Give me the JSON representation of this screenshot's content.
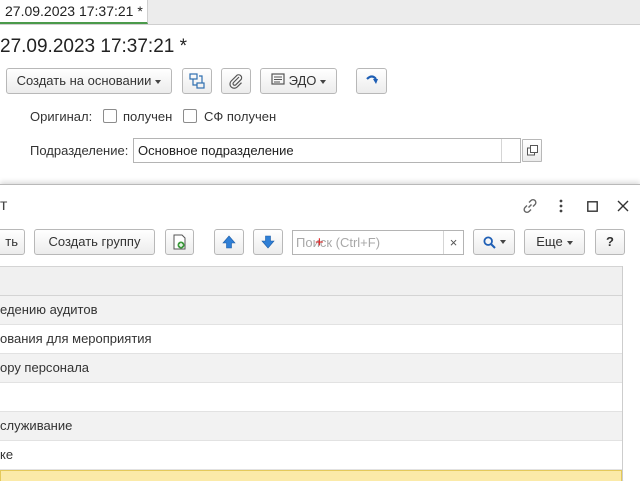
{
  "document": {
    "tab_label": "27.09.2023 17:37:21 *",
    "title": "27.09.2023 17:37:21 *",
    "toolbar": {
      "create_based_on": "Создать на основании",
      "edo": "ЭДО"
    },
    "original_label": "Оригинал:",
    "received_label": "получен",
    "sf_received_label": "СФ получен",
    "department_label": "Подразделение:",
    "department_value": "Основное подразделение"
  },
  "modal": {
    "title": "т",
    "toolbar": {
      "create_partial": "ть",
      "create_group": "Создать группу",
      "more": "Еще",
      "help": "?"
    },
    "search": {
      "placeholder": "Поиск (Ctrl+F)",
      "clear": "×"
    },
    "rows": [
      "едению аудитов",
      "ования для мероприятия",
      "ору персонала",
      "",
      "служивание",
      "ке",
      ""
    ]
  },
  "colors": {
    "tab_underline": "#4a9a4a",
    "arrow_blue": "#2f7fd6",
    "selected_row": "#fbeaa8",
    "doc_icon_green": "#3b9a3b"
  }
}
